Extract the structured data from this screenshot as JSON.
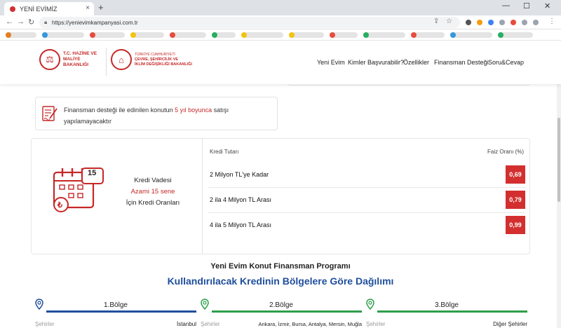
{
  "browser": {
    "tab_title": "YENİ EVİMİZ",
    "tab_close": "×",
    "new_tab": "+",
    "url": "https://yenievimkampanyasi.com.tr",
    "win_min": "—",
    "win_max": "☐",
    "win_close": "✕"
  },
  "header": {
    "logo1_text": "T.C. HAZİNE VE MALİYE BAKANLIĞI",
    "logo2_line1": "TÜRKİYE CUMHURİYETİ",
    "logo2_line2": "ÇEVRE, ŞEHİRCİLİK VE",
    "logo2_line3": "İKLİM DEĞİŞİKLİĞİ BAKANLIĞI",
    "nav": [
      "Yeni Evim",
      "Kimler Başvurabilir?",
      "Özellikler",
      "Finansman Desteği",
      "Soru&Cevap"
    ]
  },
  "notice": {
    "before": "Finansman desteği ile edinilen konutun ",
    "highlight": "5 yıl boyunca",
    "after": " satışı yapılamayacaktır"
  },
  "rates": {
    "calendar_number": "15",
    "lira_symbol": "₺",
    "title": "Kredi Vadesi",
    "term": "Azami 15 sene",
    "subtitle": "İçin Kredi Oranları",
    "col_amount": "Kredi Tutarı",
    "col_rate": "Faiz Oranı (%)",
    "rows": [
      {
        "label": "2 Milyon TL'ye Kadar",
        "rate": "0,69"
      },
      {
        "label": "2 ila 4 Milyon TL Arası",
        "rate": "0,79"
      },
      {
        "label": "4 ila 5 Milyon TL Arası",
        "rate": "0,99"
      }
    ]
  },
  "program": {
    "title": "Yeni Evim Konut Finansman Programı",
    "subtitle": "Kullandırılacak Kredinin Bölgelere Göre Dağılımı",
    "regions": [
      {
        "name": "1.Bölge",
        "key": "Şehirler",
        "value": "İstanbul",
        "color": "#1f4e9c"
      },
      {
        "name": "2.Bölge",
        "key": "Şehirler",
        "value": "Ankara, İzmir, Bursa, Antalya, Mersin, Muğla",
        "color": "#2e9e4a"
      },
      {
        "name": "3.Bölge",
        "key": "Şehirler",
        "value": "Diğer Şehirler",
        "color": "#2e9e4a"
      }
    ]
  },
  "colors": {
    "brand_red": "#c62828",
    "rate_red": "#d32f2f",
    "blue": "#1f4e9c",
    "green": "#2e9e4a"
  }
}
